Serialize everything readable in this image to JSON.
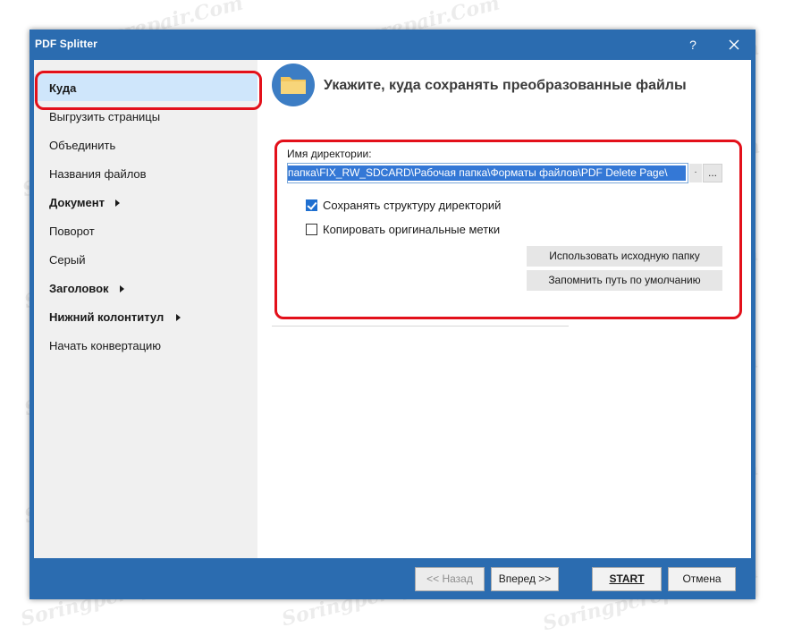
{
  "window": {
    "title": "PDF Splitter",
    "help_label": "?"
  },
  "sidebar": {
    "items": [
      {
        "label": "Куда",
        "bold": true,
        "selected": true,
        "arrow": false
      },
      {
        "label": "Выгрузить страницы",
        "bold": false,
        "selected": false,
        "arrow": false
      },
      {
        "label": "Объединить",
        "bold": false,
        "selected": false,
        "arrow": false
      },
      {
        "label": "Названия файлов",
        "bold": false,
        "selected": false,
        "arrow": false
      },
      {
        "label": "Документ",
        "bold": true,
        "selected": false,
        "arrow": true
      },
      {
        "label": "Поворот",
        "bold": false,
        "selected": false,
        "arrow": false
      },
      {
        "label": "Серый",
        "bold": false,
        "selected": false,
        "arrow": false
      },
      {
        "label": "Заголовок",
        "bold": true,
        "selected": false,
        "arrow": true
      },
      {
        "label": "Нижний колонтитул",
        "bold": true,
        "selected": false,
        "arrow": true
      },
      {
        "label": "Начать конвертацию",
        "bold": false,
        "selected": false,
        "arrow": false
      }
    ]
  },
  "main": {
    "header_title": "Укажите, куда сохранять преобразованные файлы",
    "header_icon": "folder-icon",
    "directory_label": "Имя директории:",
    "directory_value": "папка\\FIX_RW_SDCARD\\Рабочая папка\\Форматы файлов\\PDF Delete Page\\",
    "scroll_glyph": ".",
    "browse_label": "...",
    "checkboxes": [
      {
        "label": "Сохранять структуру директорий",
        "checked": true
      },
      {
        "label": "Копировать оригинальные метки",
        "checked": false
      }
    ],
    "use_source_folder_label": "Использовать исходную папку",
    "remember_default_path_label": "Запомнить путь по умолчанию"
  },
  "footer": {
    "back_label": "<< Назад",
    "next_label": "Вперед >>",
    "start_label": "START",
    "cancel_label": "Отмена"
  },
  "watermark_text": "Soringpcrepair.Com",
  "colors": {
    "accent": "#2b6cb0",
    "selection": "#cfe6fb",
    "highlight": "#e3101a",
    "folder": "#f2c55c"
  }
}
